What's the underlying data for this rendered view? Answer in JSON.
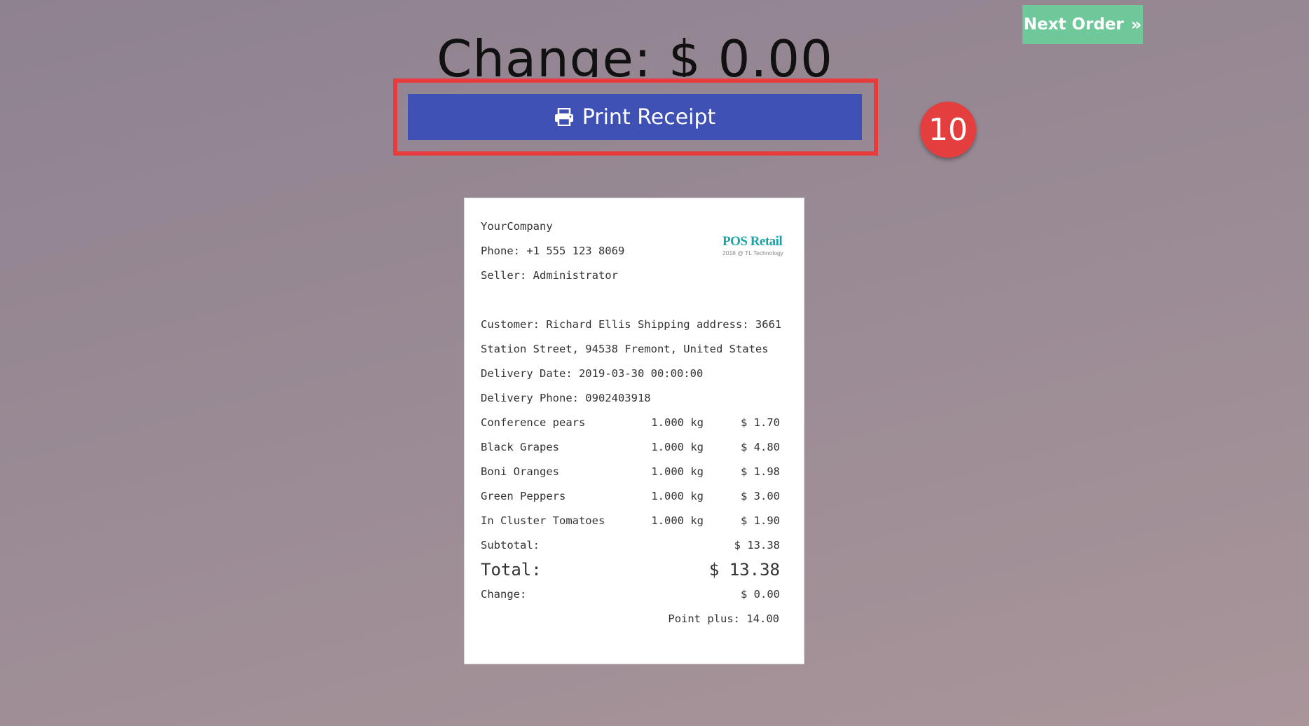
{
  "header": {
    "next_order_label": "Next Order",
    "next_order_icon": "double-chevron-right-icon",
    "change_title": "Change: $ 0.00",
    "print_label": "Print Receipt",
    "print_icon": "print-icon",
    "step_badge": "10",
    "highlight_color": "#e83b3b",
    "print_button_color": "#3f51b5",
    "next_order_color": "#6ec89a"
  },
  "receipt": {
    "company": "YourCompany",
    "phone": "Phone: +1 555 123 8069",
    "seller": "Seller: Administrator",
    "logo_title": "POS Retail",
    "logo_subtitle": "2018 @ TL Technology",
    "customer_line1": "Customer: Richard Ellis Shipping address: 3661",
    "customer_line2": "Station Street, 94538 Fremont, United States",
    "delivery_date": "Delivery Date: 2019-03-30 00:00:00",
    "delivery_phone": "Delivery Phone: 0902403918",
    "items": [
      {
        "name": "Conference pears",
        "qty": "1.000 kg",
        "price": "$ 1.70"
      },
      {
        "name": "Black Grapes",
        "qty": "1.000 kg",
        "price": "$ 4.80"
      },
      {
        "name": "Boni Oranges",
        "qty": "1.000 kg",
        "price": "$ 1.98"
      },
      {
        "name": "Green Peppers",
        "qty": "1.000 kg",
        "price": "$ 3.00"
      },
      {
        "name": "In Cluster Tomatoes",
        "qty": "1.000 kg",
        "price": "$ 1.90"
      }
    ],
    "subtotal_label": "Subtotal:",
    "subtotal_value": "$ 13.38",
    "total_label": "Total:",
    "total_value": "$ 13.38",
    "change_label": "Change:",
    "change_value": "$ 0.00",
    "points": "Point plus: 14.00"
  }
}
